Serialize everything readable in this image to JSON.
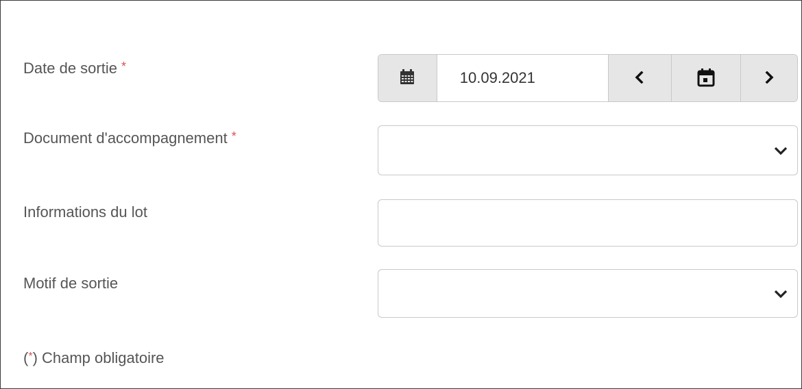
{
  "form": {
    "exit_date": {
      "label": "Date de sortie",
      "required_mark": "*",
      "value": "10.09.2021",
      "icons": {
        "addon": "calendar-grid-icon",
        "prev": "chevron-left-icon",
        "today": "calendar-today-icon",
        "next": "chevron-right-icon"
      }
    },
    "accompanying_document": {
      "label": "Document d'accompagnement",
      "required_mark": "*",
      "value": "",
      "icon": "chevron-down-icon"
    },
    "lot_info": {
      "label": "Informations du lot",
      "value": ""
    },
    "exit_reason": {
      "label": "Motif de sortie",
      "value": "",
      "icon": "chevron-down-icon"
    },
    "footnote": {
      "open": "(",
      "mark": "*",
      "text": ") Champ obligatoire"
    }
  },
  "colors": {
    "label": "#555555",
    "required": "#d9534f",
    "border": "#c8c8c8",
    "addon_bg": "#e6e6e6"
  }
}
